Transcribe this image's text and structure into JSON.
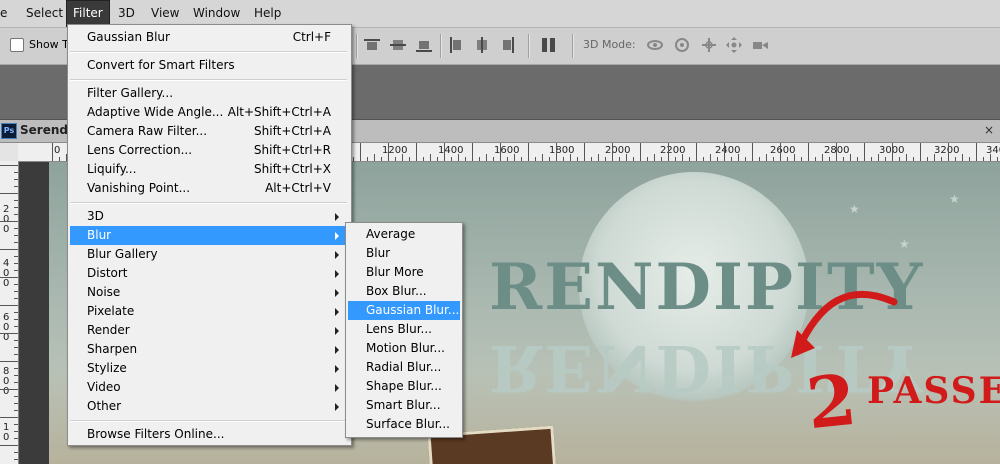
{
  "menubar": {
    "items": [
      {
        "label": "e"
      },
      {
        "label": "Select"
      },
      {
        "label": "Filter",
        "active": true
      },
      {
        "label": "3D"
      },
      {
        "label": "View"
      },
      {
        "label": "Window"
      },
      {
        "label": "Help"
      }
    ]
  },
  "options": {
    "show_label": "Show T",
    "mode_label": "3D Mode:"
  },
  "document": {
    "title": "Serendip",
    "close": "×"
  },
  "ruler": {
    "h_labels": [
      "0",
      "1200",
      "1400",
      "1600",
      "1800",
      "2000",
      "2200",
      "2400",
      "2600",
      "2800",
      "3000",
      "3200",
      "340"
    ],
    "v_labels": [
      "2",
      "0",
      "0",
      "4",
      "0",
      "0",
      "6",
      "0",
      "0",
      "8",
      "0",
      "0",
      "1",
      "0"
    ]
  },
  "filter_menu": {
    "items": [
      {
        "label": "Gaussian Blur",
        "shortcut": "Ctrl+F"
      },
      {
        "divider": true
      },
      {
        "label": "Convert for Smart Filters"
      },
      {
        "divider": true
      },
      {
        "label": "Filter Gallery..."
      },
      {
        "label": "Adaptive Wide Angle...",
        "shortcut": "Alt+Shift+Ctrl+A"
      },
      {
        "label": "Camera Raw Filter...",
        "shortcut": "Shift+Ctrl+A"
      },
      {
        "label": "Lens Correction...",
        "shortcut": "Shift+Ctrl+R"
      },
      {
        "label": "Liquify...",
        "shortcut": "Shift+Ctrl+X"
      },
      {
        "label": "Vanishing Point...",
        "shortcut": "Alt+Ctrl+V"
      },
      {
        "divider": true
      },
      {
        "label": "3D",
        "submenu": true
      },
      {
        "label": "Blur",
        "submenu": true,
        "highlighted": true
      },
      {
        "label": "Blur Gallery",
        "submenu": true
      },
      {
        "label": "Distort",
        "submenu": true
      },
      {
        "label": "Noise",
        "submenu": true
      },
      {
        "label": "Pixelate",
        "submenu": true
      },
      {
        "label": "Render",
        "submenu": true
      },
      {
        "label": "Sharpen",
        "submenu": true
      },
      {
        "label": "Stylize",
        "submenu": true
      },
      {
        "label": "Video",
        "submenu": true
      },
      {
        "label": "Other",
        "submenu": true
      },
      {
        "divider": true
      },
      {
        "label": "Browse Filters Online..."
      }
    ]
  },
  "blur_menu": {
    "items": [
      {
        "label": "Average"
      },
      {
        "label": "Blur"
      },
      {
        "label": "Blur More"
      },
      {
        "label": "Box Blur..."
      },
      {
        "label": "Gaussian Blur...",
        "highlighted": true
      },
      {
        "label": "Lens Blur..."
      },
      {
        "label": "Motion Blur..."
      },
      {
        "label": "Radial Blur..."
      },
      {
        "label": "Shape Blur..."
      },
      {
        "label": "Smart Blur..."
      },
      {
        "label": "Surface Blur..."
      }
    ]
  },
  "artwork": {
    "title": "RENDIPITY",
    "mirror_title": "RENDIPITY",
    "annotation_number": "2",
    "annotation_text": "PASSES"
  },
  "colors": {
    "highlight": "#3399ff",
    "annotation_red": "#d11b1b"
  }
}
